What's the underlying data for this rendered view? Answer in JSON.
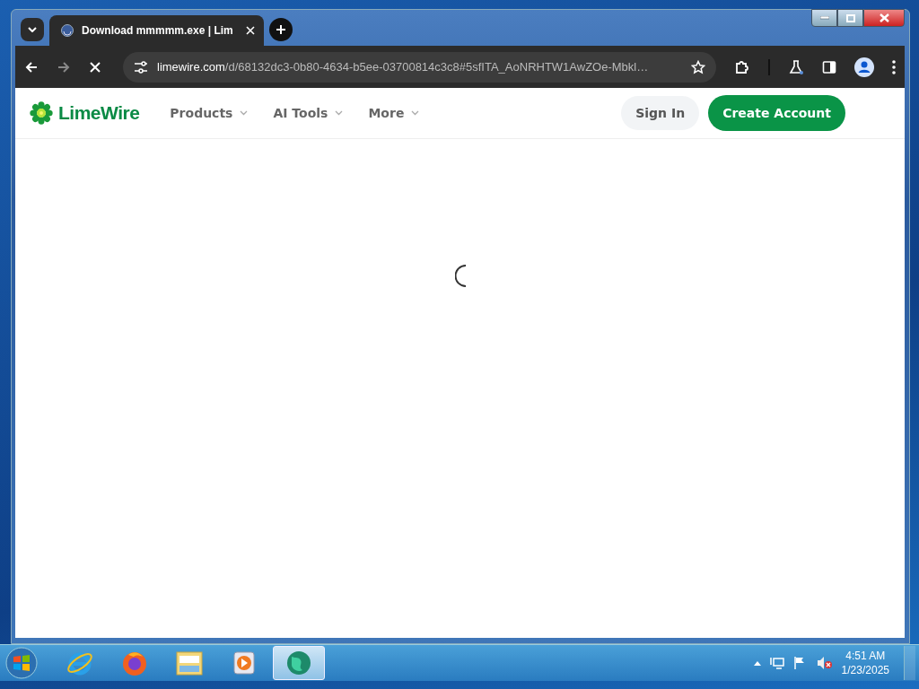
{
  "browser": {
    "tabs": [
      {
        "title": "Download mmmmm.exe | Lim",
        "selected": true
      }
    ],
    "url": {
      "domain": "limewire.com",
      "path": "/d/68132dc3-0b80-4634-b5ee-03700814c3c8#5sfITA_AoNRHTW1AwZOe-Mbkl…"
    },
    "loading": true
  },
  "site": {
    "logo": "LimeWire",
    "nav": [
      {
        "label": "Products"
      },
      {
        "label": "AI Tools"
      },
      {
        "label": "More"
      }
    ],
    "sign_in": "Sign In",
    "create_account": "Create Account"
  },
  "taskbar": {
    "apps": [
      {
        "kind": "ie",
        "selected": false
      },
      {
        "kind": "firefox",
        "selected": false
      },
      {
        "kind": "explorer",
        "selected": false
      },
      {
        "kind": "media",
        "selected": false
      },
      {
        "kind": "globe",
        "selected": true
      }
    ],
    "clock": {
      "time": "4:51 AM",
      "date": "1/23/2025"
    }
  }
}
